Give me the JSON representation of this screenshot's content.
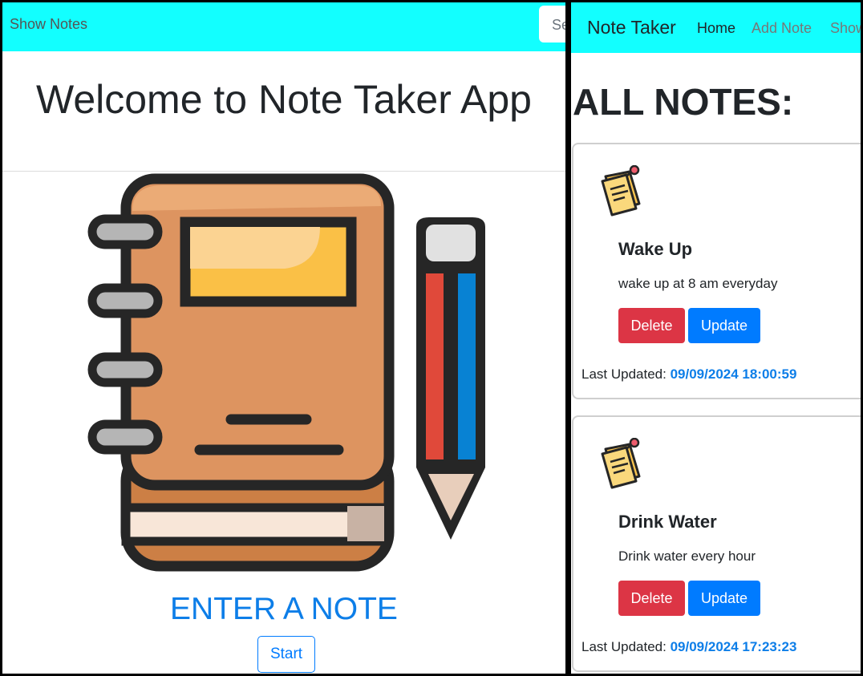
{
  "left_page": {
    "navbar": {
      "show_notes_link": "Show Notes",
      "search_placeholder": "Search"
    },
    "welcome_heading": "Welcome to Note Taker App",
    "illustration_icon": "notebook-pencil-illustration",
    "enter_note_text": "ENTER A NOTE",
    "start_button": "Start"
  },
  "right_page": {
    "navbar": {
      "brand": "Note Taker",
      "links": [
        "Home",
        "Add Note",
        "Show Notes"
      ]
    },
    "heading": "ALL NOTES:",
    "note_icon": "sticky-note-icon",
    "last_updated_label": "Last Updated:",
    "delete_label": "Delete",
    "update_label": "Update",
    "notes": [
      {
        "title": "Wake Up",
        "content": "wake up at 8 am everyday",
        "last_updated": "09/09/2024 18:00:59"
      },
      {
        "title": "Drink Water",
        "content": "Drink water every hour",
        "last_updated": "09/09/2024 17:23:23"
      }
    ]
  },
  "colors": {
    "navbar_bg": "#12ffff",
    "accent_blue": "#007bff",
    "delete_red": "#dc3545",
    "link_blue": "#0d7ee8"
  }
}
